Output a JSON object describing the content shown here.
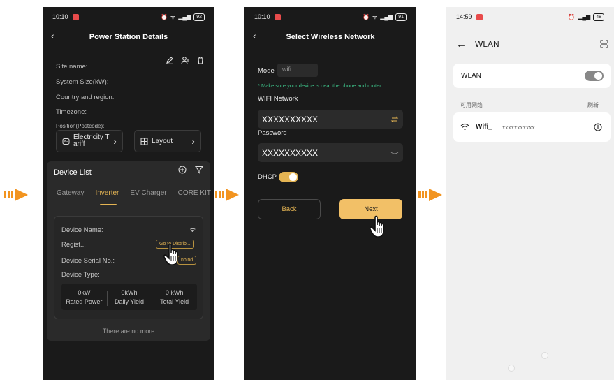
{
  "colors": {
    "accent": "#e4b453",
    "arrow": "#f29420",
    "success": "#3dc48a",
    "dark_bg": "#1a1a1a",
    "light_bg": "#f0f0f0",
    "toggle_off_track": "#888888"
  },
  "screen1": {
    "time": "10:10",
    "battery": "92",
    "title": "Power Station Details",
    "info_labels": [
      "Site name:",
      "System Size(kW):",
      "Country and region:",
      "Timezone:",
      "Position(Postcode):"
    ],
    "electricity_btn": "Electricity T ariff",
    "layout_btn": "Layout",
    "device_list_title": "Device List",
    "tabs": [
      "Gateway",
      "Inverter",
      "EV Charger",
      "CORE KIT"
    ],
    "active_tab": "Inverter",
    "device": {
      "name_label": "Device Name:",
      "regist_label": "Regist...",
      "go_button": "Go to Distrib...",
      "serial_label": "Device Serial No.:",
      "unbind_button": "nbind",
      "type_label": "Device Type:",
      "stats": [
        {
          "value": "0kW",
          "label": "Rated Power"
        },
        {
          "value": "0kWh",
          "label": "Daily Yield"
        },
        {
          "value": "0 kWh",
          "label": "Total Yield"
        }
      ]
    },
    "no_more": "There are no more"
  },
  "screen2": {
    "time": "10:10",
    "battery": "91",
    "title": "Select Wireless Network",
    "mode_label": "Mode",
    "mode_value": "wifi",
    "hint": "* Make sure your device is near the phone and router.",
    "wifi_label": "WIFI Network",
    "wifi_value": "XXXXXXXXXX",
    "password_label": "Password",
    "password_value": "XXXXXXXXXX",
    "dhcp_label": "DHCP",
    "dhcp_on": true,
    "back_btn": "Back",
    "next_btn": "Next"
  },
  "screen3": {
    "time": "14:59",
    "battery": "48",
    "title": "WLAN",
    "wlan_label": "WLAN",
    "wlan_on": false,
    "available_label": "可用网络",
    "refresh_label": "刷新",
    "network_name": "Wifi_",
    "network_suffix": "xxxxxxxxxxx"
  }
}
